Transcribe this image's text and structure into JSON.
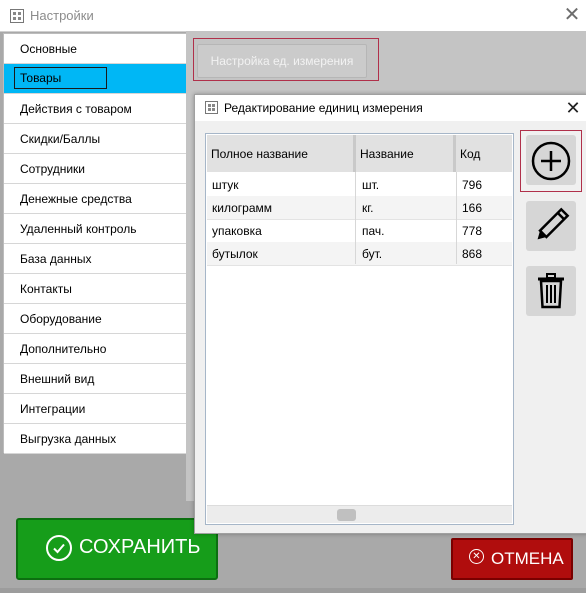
{
  "window": {
    "title": "Настройки",
    "close_glyph": "✕"
  },
  "sidebar": {
    "items": [
      {
        "label": "Основные"
      },
      {
        "label": "Товары",
        "selected": true
      },
      {
        "label": "Действия с товаром"
      },
      {
        "label": "Скидки/Баллы"
      },
      {
        "label": "Сотрудники"
      },
      {
        "label": "Денежные средства"
      },
      {
        "label": "Удаленный контроль"
      },
      {
        "label": "База данных"
      },
      {
        "label": "Контакты"
      },
      {
        "label": "Оборудование"
      },
      {
        "label": "Дополнительно"
      },
      {
        "label": "Внешний вид"
      },
      {
        "label": "Интеграции"
      },
      {
        "label": "Выгрузка данных"
      }
    ],
    "selected_color": "#00b7f5"
  },
  "panel": {
    "unit_button_label": "Настройка ед. измерения"
  },
  "dialog": {
    "title": "Редактирование единиц измерения",
    "close_glyph": "✕",
    "table": {
      "columns": [
        "Полное название",
        "Название",
        "Код"
      ],
      "rows": [
        [
          "штук",
          "шт.",
          "796"
        ],
        [
          "килограмм",
          "кг.",
          "166"
        ],
        [
          "упаковка",
          "пач.",
          "778"
        ],
        [
          "бутылок",
          "бут.",
          "868"
        ]
      ]
    },
    "actions": {
      "add_icon": "plus-circle-icon",
      "edit_icon": "pencil-icon",
      "delete_icon": "trash-icon"
    }
  },
  "footer": {
    "save_label": "СОХРАНИТЬ",
    "cancel_label": "ОТМЕНА",
    "cancel_glyph": "✕",
    "save_color": "#169d1a",
    "cancel_color": "#b00d0d"
  }
}
